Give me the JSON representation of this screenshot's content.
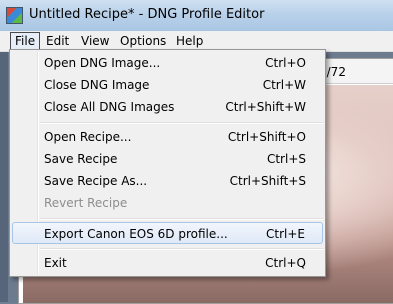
{
  "window": {
    "title": "Untitled Recipe* - DNG Profile Editor"
  },
  "menubar": {
    "items": [
      "File",
      "Edit",
      "View",
      "Options",
      "Help"
    ]
  },
  "document": {
    "counter": "0/72"
  },
  "file_menu": {
    "items": [
      {
        "label": "Open DNG Image...",
        "shortcut": "Ctrl+O"
      },
      {
        "label": "Close DNG Image",
        "shortcut": "Ctrl+W"
      },
      {
        "label": "Close All DNG Images",
        "shortcut": "Ctrl+Shift+W"
      },
      {
        "label": "Open Recipe...",
        "shortcut": "Ctrl+Shift+O"
      },
      {
        "label": "Save Recipe",
        "shortcut": "Ctrl+S"
      },
      {
        "label": "Save Recipe As...",
        "shortcut": "Ctrl+Shift+S"
      },
      {
        "label": "Revert Recipe",
        "shortcut": ""
      },
      {
        "label": "Export Canon EOS 6D profile...",
        "shortcut": "Ctrl+E"
      },
      {
        "label": "Exit",
        "shortcut": "Ctrl+Q"
      }
    ]
  }
}
